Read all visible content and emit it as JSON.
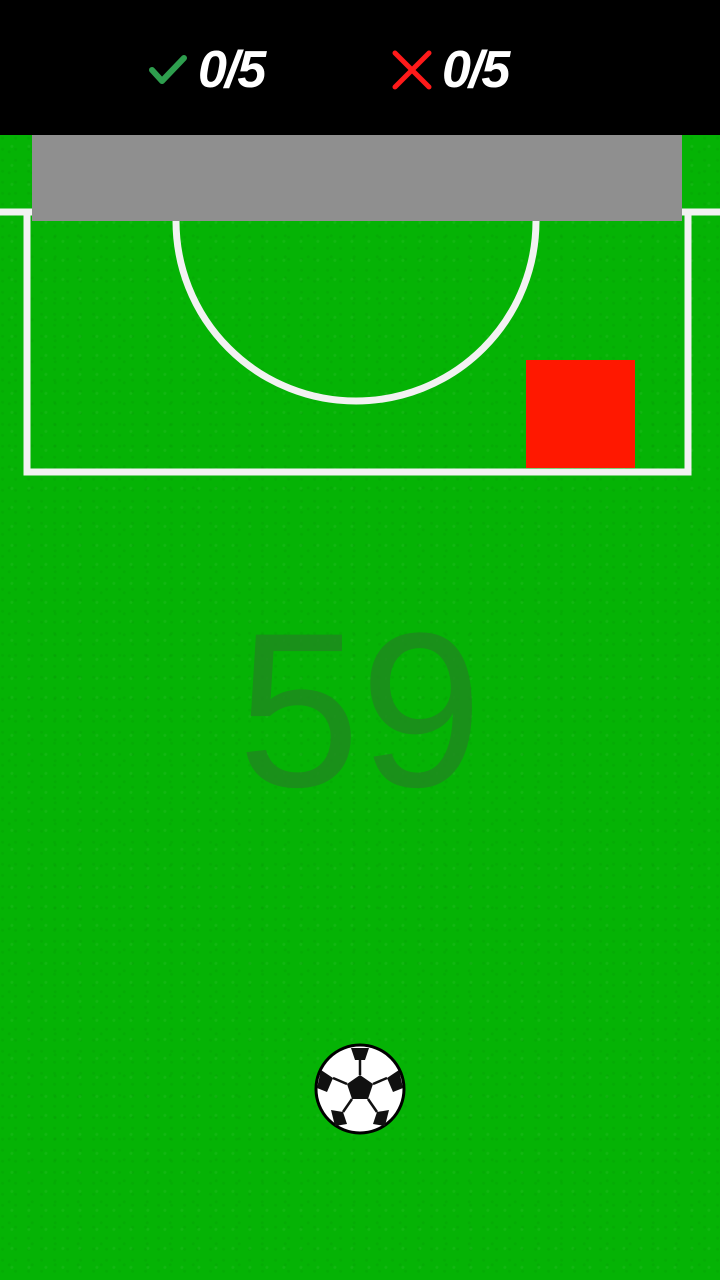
{
  "hud": {
    "goals_icon": "check-icon",
    "goals_value": "0/5",
    "goals_color": "#2e9e4e",
    "misses_icon": "cross-icon",
    "misses_value": "0/5",
    "misses_color": "#ff1a1a"
  },
  "game": {
    "countdown": "59",
    "keeper_color": "#ff1800",
    "goal_color": "#8f8f8f",
    "pitch_color": "#05b305",
    "ball_icon": "soccer-ball-icon"
  }
}
